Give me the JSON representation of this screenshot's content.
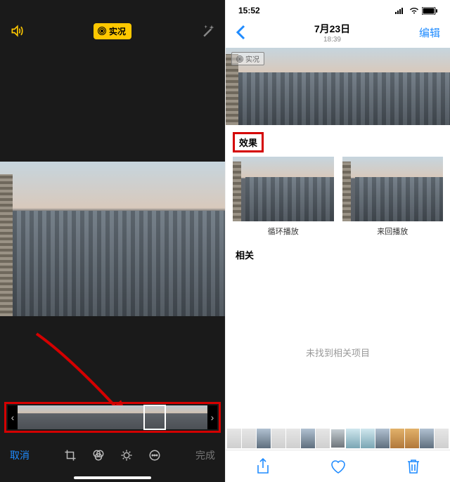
{
  "left": {
    "live_badge": "实况",
    "cancel": "取消",
    "done": "完成",
    "icons": {
      "volume": "volume-icon",
      "wand": "magic-wand-icon",
      "crop": "crop-icon",
      "filters": "filters-icon",
      "adjust": "adjust-icon",
      "more": "more-icon"
    },
    "filmstrip": {
      "frame_count": 9,
      "selected_index": 6
    }
  },
  "right": {
    "status": {
      "time": "15:52",
      "signal": "signal-icon",
      "wifi": "wifi-icon",
      "battery": "battery-icon"
    },
    "header": {
      "date": "7月23日",
      "time": "18:39",
      "edit": "编辑"
    },
    "hero_live_badge": "实况",
    "sections": {
      "effects_label": "效果",
      "related_label": "相关",
      "empty_text": "未找到相关项目"
    },
    "effects": [
      {
        "label": "循环播放"
      },
      {
        "label": "来回播放"
      }
    ],
    "bottom_strip_count": 15,
    "toolbar": {
      "share": "share-icon",
      "favorite": "heart-icon",
      "delete": "trash-icon"
    }
  },
  "annotations": {
    "arrow": "red-arrow",
    "filmstrip_box": "red-highlight-box",
    "effects_box": "red-highlight-box"
  }
}
